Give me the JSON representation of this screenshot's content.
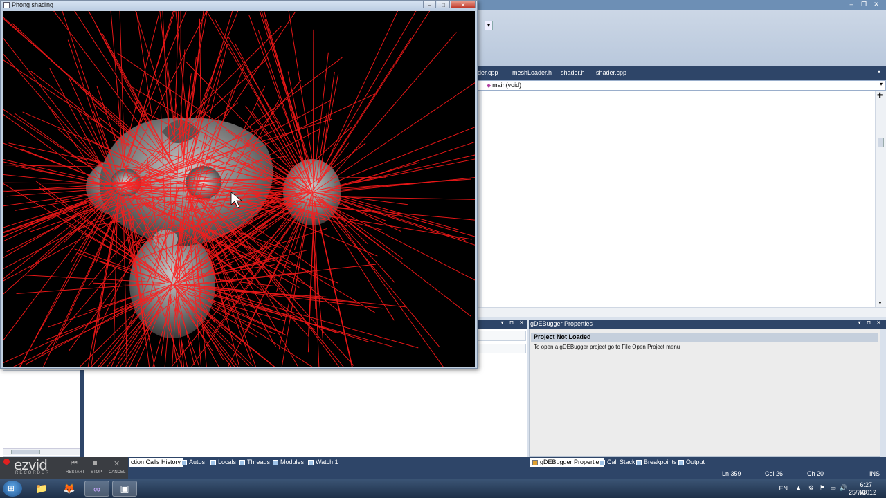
{
  "gl_window": {
    "title": "Phong shading",
    "controls": {
      "minimize": "–",
      "maximize": "□",
      "close": "✕"
    }
  },
  "ide": {
    "window_controls": {
      "minimize": "–",
      "restore": "❐",
      "close": "✕"
    },
    "tabs": [
      "der.cpp",
      "meshLoader.h",
      "shader.h",
      "shader.cpp"
    ],
    "function_selector": "main(void)",
    "left_panel_controls": "▾ ⊓ ✕",
    "properties_panel": {
      "title": "gDEBugger Properties",
      "controls": "▾ ⊓ ✕",
      "header": "Project Not Loaded",
      "message": "To open a gDEBugger project go to File Open Project menu"
    },
    "bottom_tabs_left": [
      "ction Calls History",
      "Autos",
      "Locals",
      "Threads",
      "Modules",
      "Watch 1"
    ],
    "bottom_tabs_right": [
      "gDEBugger Properties",
      "Call Stack",
      "Breakpoints",
      "Output"
    ],
    "status": {
      "line": "Ln 359",
      "col": "Col 26",
      "ch": "Ch 20",
      "mode": "INS"
    }
  },
  "ezvid": {
    "logo": "ezvid",
    "subtitle": "RECORDER",
    "buttons": [
      {
        "label": "RESTART",
        "icon": "⏮"
      },
      {
        "label": "STOP",
        "icon": "■"
      },
      {
        "label": "CANCEL",
        "icon": "✕"
      }
    ]
  },
  "taskbar": {
    "apps": [
      {
        "name": "explorer-icon",
        "glyph": "📁"
      },
      {
        "name": "firefox-icon",
        "glyph": "🦊"
      },
      {
        "name": "visual-studio-icon",
        "glyph": "∞"
      },
      {
        "name": "console-app-icon",
        "glyph": "▣"
      }
    ],
    "tray": {
      "language": "EN",
      "time": "6:27 μμ",
      "date": "25/7/2012"
    }
  },
  "colors": {
    "ide_dark": "#2e4568",
    "line_red": "#ff1a1a",
    "background_black": "#000000"
  }
}
